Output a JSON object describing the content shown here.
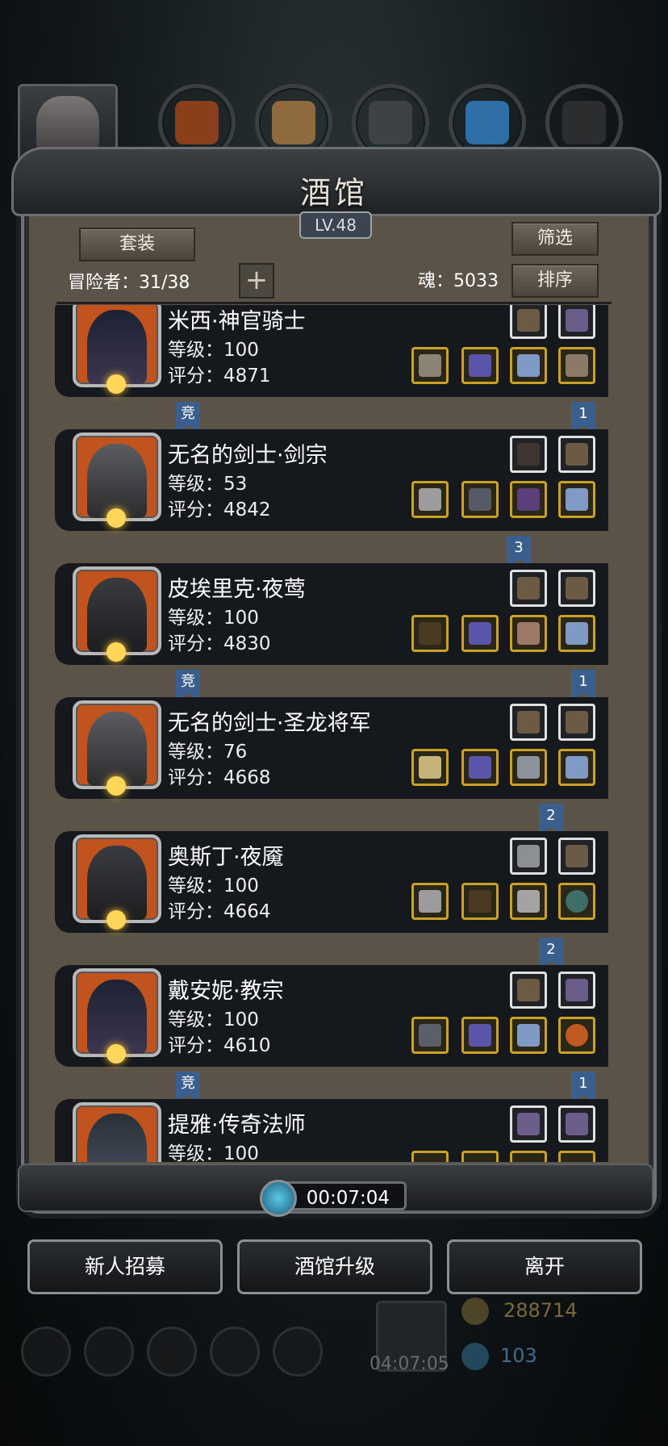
{
  "window": {
    "title": "酒馆",
    "level": "LV.48"
  },
  "toolbar": {
    "set_label": "套装",
    "filter_label": "筛选",
    "sort_label": "排序",
    "adventurers_text": "冒险者：31/38",
    "souls_text": "魂：5033",
    "add_symbol": "+"
  },
  "heroes": [
    {
      "name": "米西·神官骑士",
      "level": "等级：100",
      "score": "评分：4871",
      "portrait": "priestess",
      "left_tag": "竞",
      "right_tag": "1"
    },
    {
      "name": "无名的剑士·剑宗",
      "level": "等级：53",
      "score": "评分：4842",
      "portrait": "knight",
      "left_tag": "",
      "right_tag": "3"
    },
    {
      "name": "皮埃里克·夜莺",
      "level": "等级：100",
      "score": "评分：4830",
      "portrait": "assassin",
      "left_tag": "竞",
      "right_tag": "1"
    },
    {
      "name": "无名的剑士·圣龙将军",
      "level": "等级：76",
      "score": "评分：4668",
      "portrait": "knight",
      "left_tag": "",
      "right_tag": "2"
    },
    {
      "name": "奥斯丁·夜魇",
      "level": "等级：100",
      "score": "评分：4664",
      "portrait": "assassin",
      "left_tag": "",
      "right_tag": "2"
    },
    {
      "name": "戴安妮·教宗",
      "level": "等级：100",
      "score": "评分：4610",
      "portrait": "priestess",
      "left_tag": "竞",
      "right_tag": "1"
    },
    {
      "name": "提雅·传奇法师",
      "level": "等级：100",
      "score": "",
      "portrait": "mage",
      "left_tag": "",
      "right_tag": ""
    }
  ],
  "timer": "00:07:04",
  "actions": {
    "recruit_label": "新人招募",
    "upgrade_label": "酒馆升级",
    "leave_label": "离开"
  },
  "background": {
    "gift_timer": "04:07:05",
    "gold": "288714",
    "gems": "103"
  },
  "colors": {
    "panel": "#5b5347",
    "card": "#15181d",
    "hero_frame": "#c1541e",
    "rank_ribbon": "#3a5f8c",
    "legend_border": "#c9a227"
  },
  "icons": [
    "wood-resource-icon",
    "stone-resource-icon",
    "iron-resource-icon",
    "crystal-resource-icon",
    "timer-icon",
    "gift-icon",
    "gold-coin-icon",
    "gem-icon"
  ]
}
